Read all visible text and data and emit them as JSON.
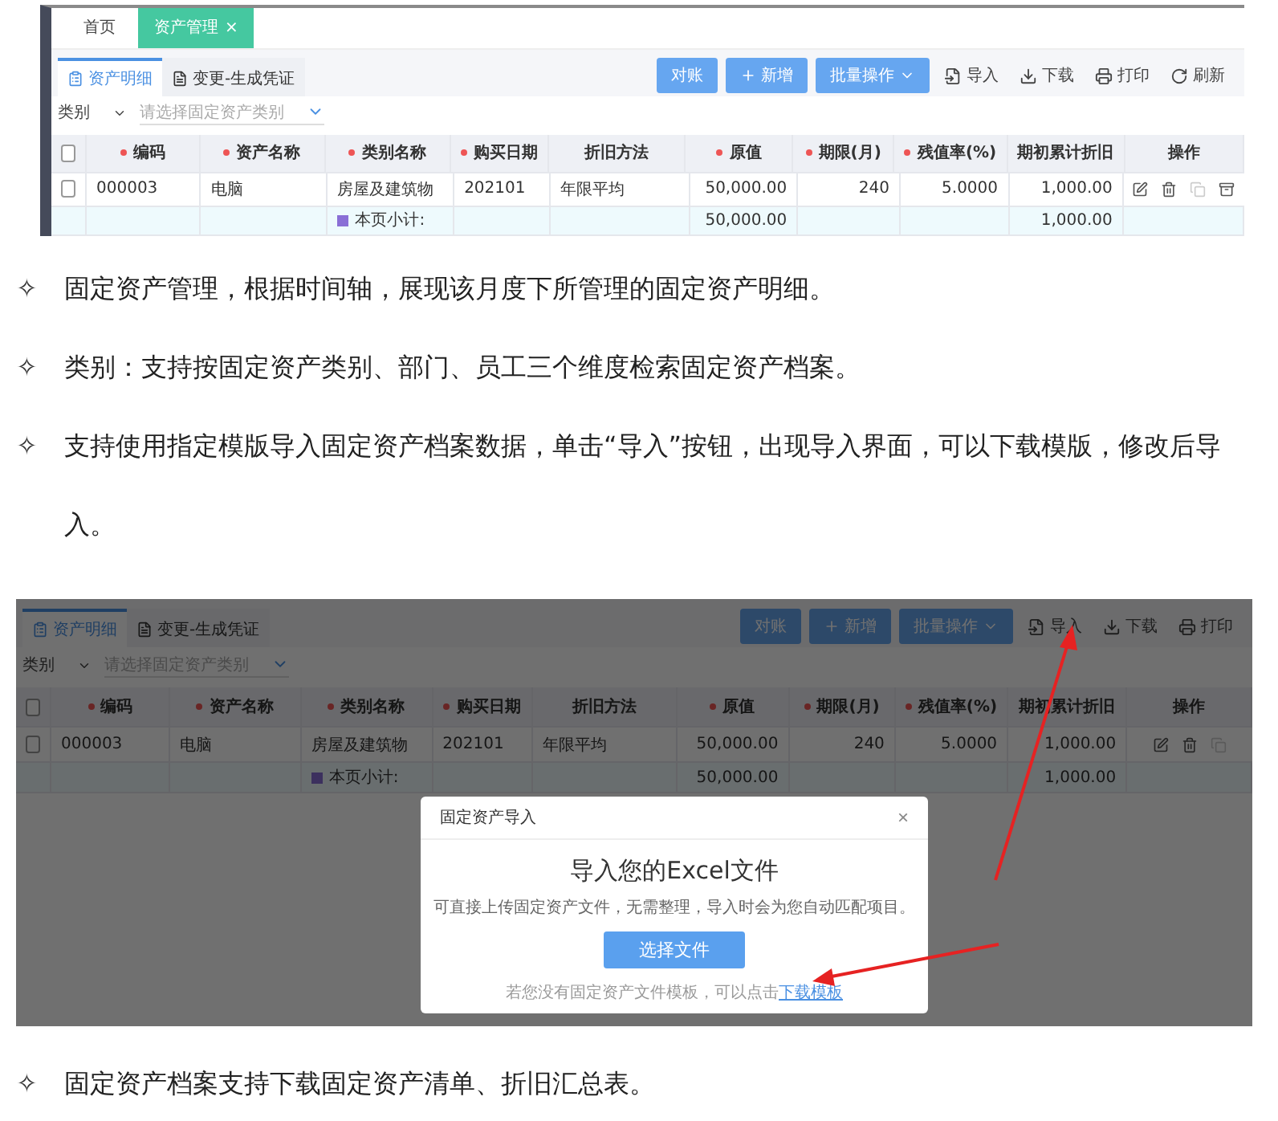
{
  "screenshot_1": {
    "dimmed": false,
    "tabs": [
      {
        "label": "首页",
        "selected": false
      },
      {
        "label": "资产管理",
        "selected": true,
        "close": "×"
      }
    ],
    "subtabs": [
      {
        "label": "资产明细",
        "selected": true
      },
      {
        "label": "变更-生成凭证",
        "selected": false
      }
    ],
    "filter": {
      "field": "类别",
      "placeholder": "请选择固定资产类别"
    },
    "actions": [
      {
        "kind": "primary",
        "label": "对账"
      },
      {
        "kind": "add",
        "label": "新增"
      },
      {
        "kind": "menu",
        "label": "批量操作"
      },
      {
        "kind": "import",
        "label": "导入"
      },
      {
        "kind": "download",
        "label": "下载"
      },
      {
        "kind": "print",
        "label": "打印"
      },
      {
        "kind": "refresh",
        "label": "刷新"
      }
    ],
    "header_checked": false,
    "columns": [
      {
        "label": "编码",
        "required": true,
        "numeric": false
      },
      {
        "label": "资产名称",
        "required": true,
        "numeric": false
      },
      {
        "label": "类别名称",
        "required": true,
        "numeric": false
      },
      {
        "label": "购买日期",
        "required": true,
        "numeric": false
      },
      {
        "label": "折旧方法",
        "required": false
      },
      {
        "label": "原值",
        "required": true,
        "numeric": true
      },
      {
        "label": "期限(月)",
        "required": true,
        "numeric": true
      },
      {
        "label": "残值率(%)",
        "required": true,
        "numeric": true
      },
      {
        "label": "期初累计折旧",
        "required": false,
        "numeric": true
      },
      {
        "label": "操作",
        "required": false
      }
    ],
    "rows": [
      {
        "checked": false,
        "cells": [
          "000003",
          "电脑",
          "房屋及建筑物",
          "202101",
          "年限平均",
          "50,000.00",
          "240",
          "5.0000",
          "1,000.00"
        ],
        "actions": [
          {
            "kind": "edit",
            "disabled": false
          },
          {
            "kind": "delete",
            "disabled": false
          },
          {
            "kind": "copy",
            "disabled": true
          },
          {
            "kind": "dispose",
            "disabled": false
          }
        ]
      }
    ],
    "subtotal": {
      "label": "本页小计:",
      "original_value": "50,000.00",
      "opening_depreciation": "1,000.00"
    }
  },
  "bullets": [
    {
      "marker": "✧",
      "text": "固定资产管理，根据时间轴，展现该月度下所管理的固定资产明细。"
    },
    {
      "marker": "✧",
      "text": "类别：支持按固定资产类别、部门、员工三个维度检索固定资产档案。"
    },
    {
      "marker": "✧",
      "text": "支持使用指定模版导入固定资产档案数据，单击“导入”按钮，出现导入界面，可以下载模版，修改后导入。"
    }
  ],
  "screenshot_2": {
    "dimmed": true,
    "subtabs": [
      {
        "label": "资产明细",
        "selected": true
      },
      {
        "label": "变更-生成凭证",
        "selected": false
      }
    ],
    "filter": {
      "field": "类别",
      "placeholder": "请选择固定资产类别"
    },
    "actions": [
      {
        "kind": "primary",
        "label": "对账"
      },
      {
        "kind": "add",
        "label": "新增"
      },
      {
        "kind": "menu",
        "label": "批量操作"
      },
      {
        "kind": "import",
        "label": "导入"
      },
      {
        "kind": "download",
        "label": "下载"
      },
      {
        "kind": "print",
        "label": "打印"
      }
    ],
    "header_checked": false,
    "columns": [
      {
        "label": "编码",
        "required": true,
        "numeric": false
      },
      {
        "label": "资产名称",
        "required": true,
        "numeric": false
      },
      {
        "label": "类别名称",
        "required": true,
        "numeric": false
      },
      {
        "label": "购买日期",
        "required": true,
        "numeric": false
      },
      {
        "label": "折旧方法",
        "required": false
      },
      {
        "label": "原值",
        "required": true,
        "numeric": true
      },
      {
        "label": "期限(月)",
        "required": true,
        "numeric": true
      },
      {
        "label": "残值率(%)",
        "required": true,
        "numeric": true
      },
      {
        "label": "期初累计折旧",
        "required": false,
        "numeric": true
      },
      {
        "label": "操作",
        "required": false
      }
    ],
    "rows": [
      {
        "checked": false,
        "cells": [
          "000003",
          "电脑",
          "房屋及建筑物",
          "202101",
          "年限平均",
          "50,000.00",
          "240",
          "5.0000",
          "1,000.00"
        ],
        "actions": [
          {
            "kind": "edit",
            "disabled": false
          },
          {
            "kind": "delete",
            "disabled": false
          },
          {
            "kind": "copy",
            "disabled": true
          }
        ]
      }
    ],
    "subtotal": {
      "label": "本页小计:",
      "original_value": "50,000.00",
      "opening_depreciation": "1,000.00"
    },
    "dialog": {
      "title": "固定资产导入",
      "close": "×",
      "heading": "导入您的Excel文件",
      "description": "可直接上传固定资产文件，无需整理，导入时会为您自动匹配项目。",
      "button": "选择文件",
      "note": "若您没有固定资产文件模板，可以点击",
      "link": "下载模板"
    }
  },
  "bullets_2": [
    {
      "marker": "✧",
      "text": "固定资产档案支持下载固定资产清单、折旧汇总表。"
    }
  ]
}
